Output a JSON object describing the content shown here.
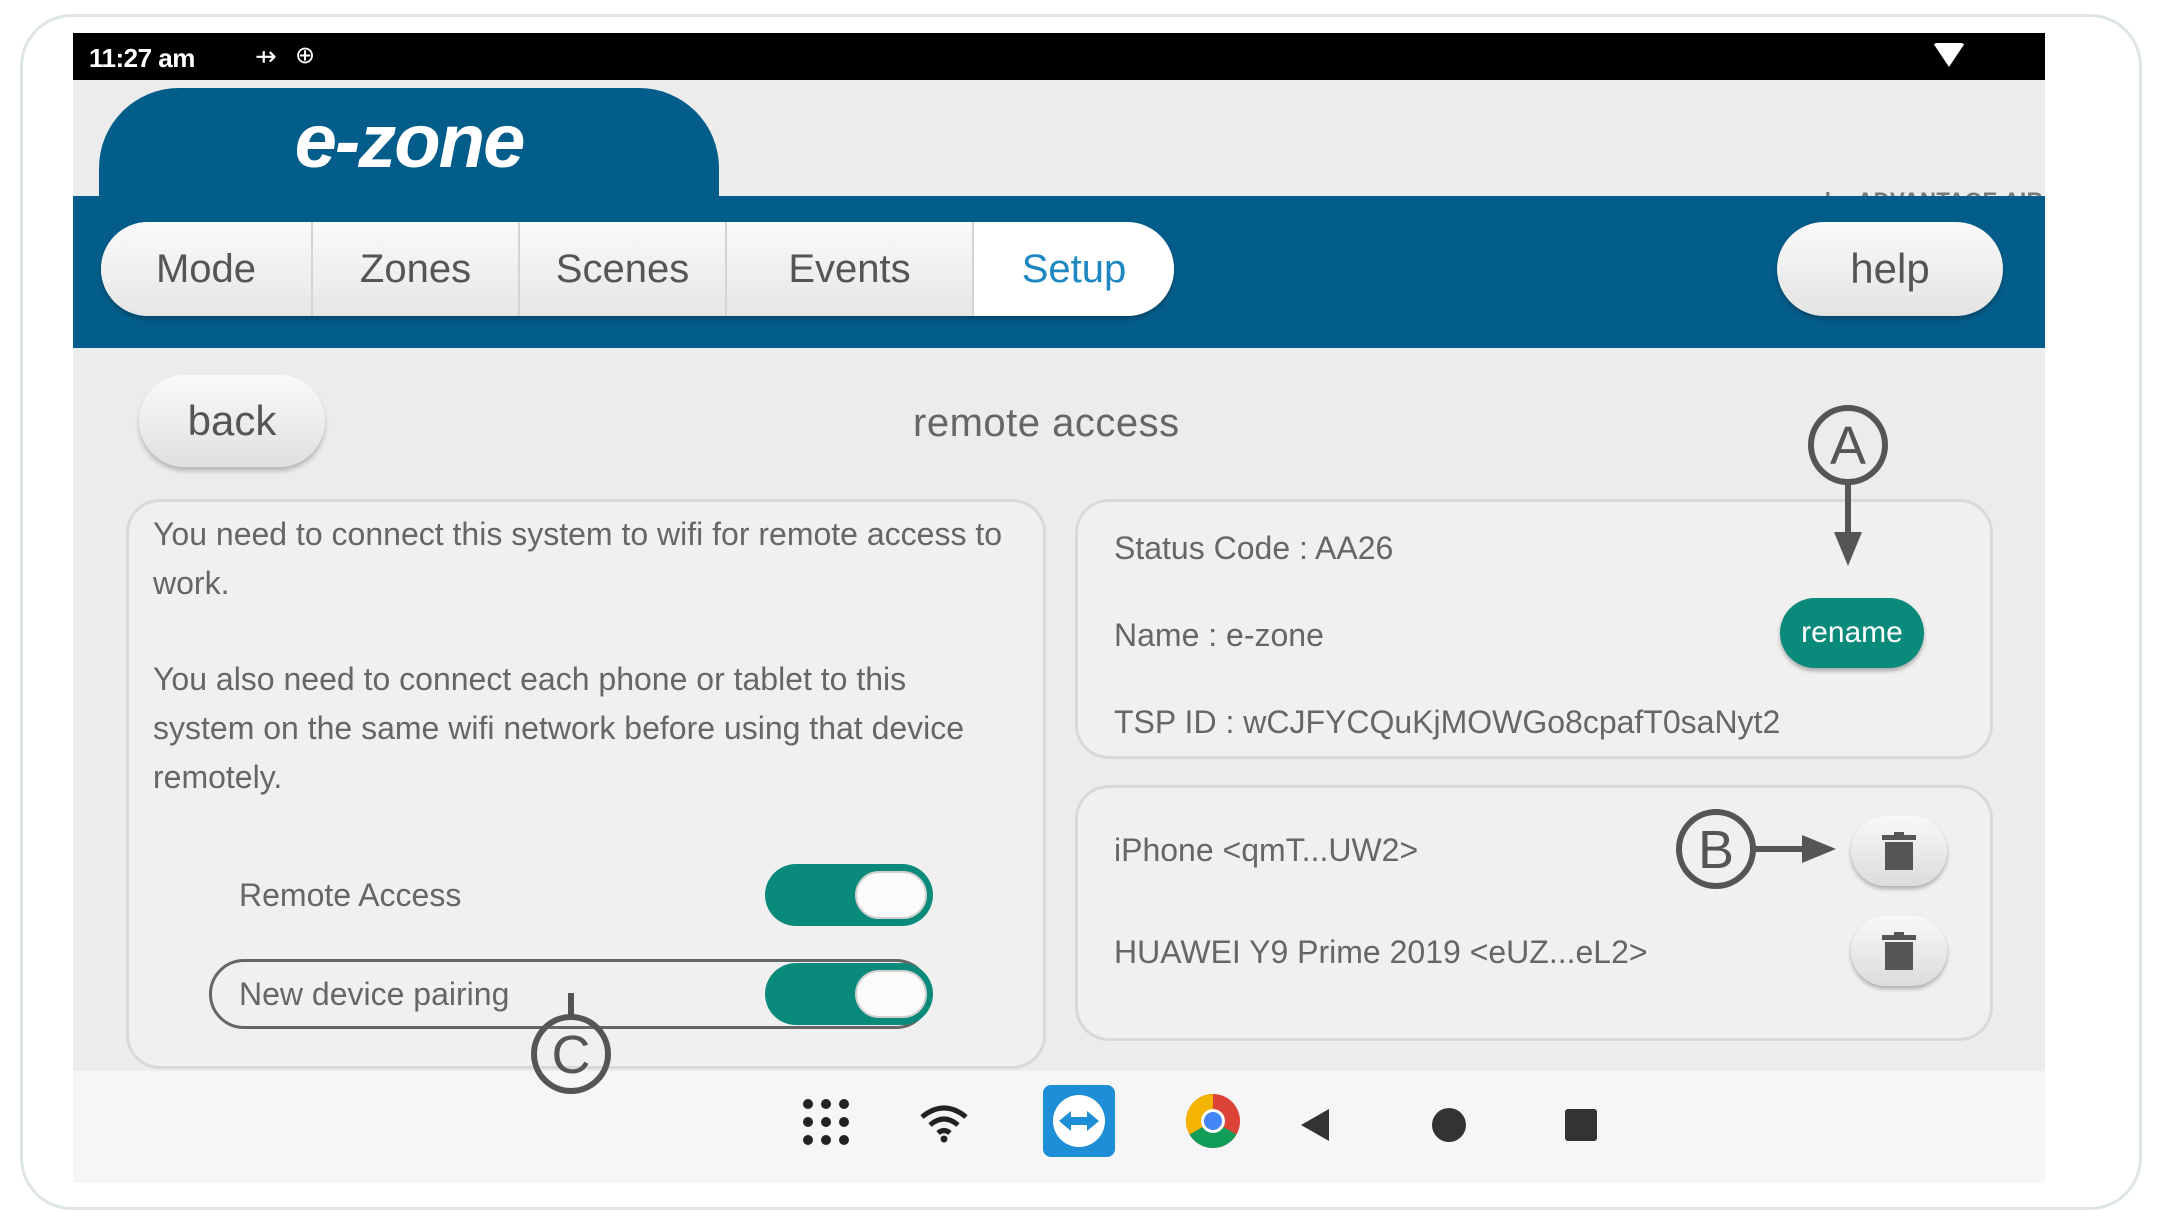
{
  "status_bar": {
    "time": "11:27 am",
    "usb_icon": "usb-icon",
    "wifi_icon": "wifi-icon"
  },
  "header": {
    "logo": "e-zone",
    "brand": "by ADVANTAGE AIR"
  },
  "tabs": [
    {
      "label": "Mode",
      "active": false
    },
    {
      "label": "Zones",
      "active": false
    },
    {
      "label": "Scenes",
      "active": false
    },
    {
      "label": "Events",
      "active": false
    },
    {
      "label": "Setup",
      "active": true
    }
  ],
  "help_label": "help",
  "back_label": "back",
  "page_title": "remote access",
  "left_panel": {
    "para1": "You need to connect this system to wifi for remote access to work.",
    "para2": "You also need to connect each phone or tablet to this system on the same wifi network before using that device remotely.",
    "remote_access_label": "Remote Access",
    "remote_access_on": true,
    "new_device_label": "New device pairing",
    "new_device_on": true
  },
  "status_panel": {
    "status_code": "Status Code : AA26",
    "name": "Name : e-zone",
    "tsp_id": "TSP ID : wCJFYCQuKjMOWGo8cpafT0saNyt2",
    "rename_label": "rename"
  },
  "devices": [
    {
      "label": "iPhone <qmT...UW2>"
    },
    {
      "label": "HUAWEI Y9 Prime 2019 <eUZ...eL2>"
    }
  ],
  "callouts": {
    "a": "A",
    "b": "B",
    "c": "C"
  },
  "colors": {
    "header_blue": "#035d8a",
    "teal": "#0a8a7a",
    "active_tab": "#1c87c0"
  }
}
